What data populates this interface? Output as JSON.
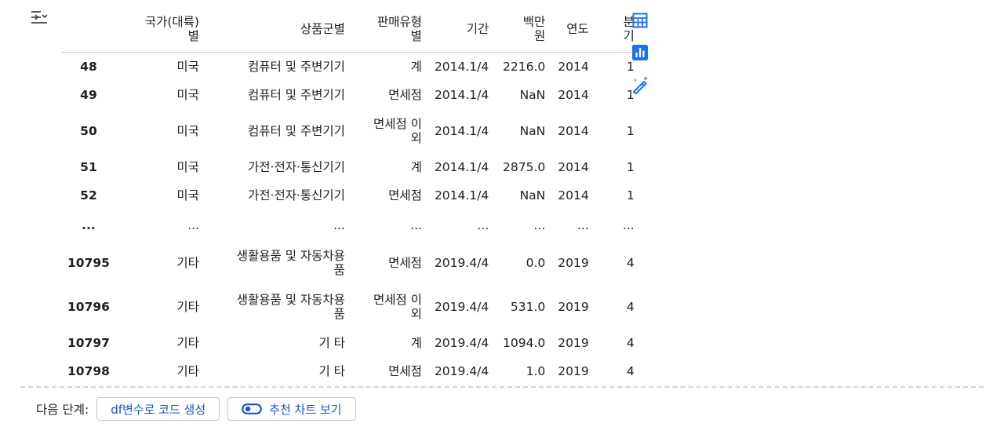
{
  "table": {
    "header": [
      "",
      "국가(대륙)\n별",
      "상품군별",
      "판매유형\n별",
      "기간",
      "백만\n원",
      "연도",
      "분\n기"
    ],
    "rows": [
      {
        "idx": "48",
        "country": "미국",
        "product": "컴퓨터 및 주변기기",
        "sale_type": "계",
        "period": "2014.1/4",
        "amount": "2216.0",
        "year": "2014",
        "quarter": "1",
        "kind": "norm"
      },
      {
        "idx": "49",
        "country": "미국",
        "product": "컴퓨터 및 주변기기",
        "sale_type": "면세점",
        "period": "2014.1/4",
        "amount": "NaN",
        "year": "2014",
        "quarter": "1",
        "kind": "norm"
      },
      {
        "idx": "50",
        "country": "미국",
        "product": "컴퓨터 및 주변기기",
        "sale_type": "면세점 이\n외",
        "period": "2014.1/4",
        "amount": "NaN",
        "year": "2014",
        "quarter": "1",
        "kind": "wrap"
      },
      {
        "idx": "51",
        "country": "미국",
        "product": "가전·전자·통신기기",
        "sale_type": "계",
        "period": "2014.1/4",
        "amount": "2875.0",
        "year": "2014",
        "quarter": "1",
        "kind": "norm"
      },
      {
        "idx": "52",
        "country": "미국",
        "product": "가전·전자·통신기기",
        "sale_type": "면세점",
        "period": "2014.1/4",
        "amount": "NaN",
        "year": "2014",
        "quarter": "1",
        "kind": "norm"
      },
      {
        "idx": "...",
        "country": "...",
        "product": "...",
        "sale_type": "...",
        "period": "...",
        "amount": "...",
        "year": "...",
        "quarter": "...",
        "kind": "ell"
      },
      {
        "idx": "10795",
        "country": "기타",
        "product": "생활용품 및 자동차용\n품",
        "sale_type": "면세점",
        "period": "2019.4/4",
        "amount": "0.0",
        "year": "2019",
        "quarter": "4",
        "kind": "wrap"
      },
      {
        "idx": "10796",
        "country": "기타",
        "product": "생활용품 및 자동차용\n품",
        "sale_type": "면세점 이\n외",
        "period": "2019.4/4",
        "amount": "531.0",
        "year": "2019",
        "quarter": "4",
        "kind": "wrap"
      },
      {
        "idx": "10797",
        "country": "기타",
        "product": "기 타",
        "sale_type": "계",
        "period": "2019.4/4",
        "amount": "1094.0",
        "year": "2019",
        "quarter": "4",
        "kind": "norm"
      },
      {
        "idx": "10798",
        "country": "기타",
        "product": "기 타",
        "sale_type": "면세점",
        "period": "2019.4/4",
        "amount": "1.0",
        "year": "2019",
        "quarter": "4",
        "kind": "norm"
      }
    ]
  },
  "side_tools": [
    {
      "name": "table-view-icon"
    },
    {
      "name": "chart-view-icon"
    },
    {
      "name": "magic-wand-icon"
    }
  ],
  "next_steps": {
    "label": "다음 단계:",
    "buttons": [
      {
        "label": "df변수로 코드 생성"
      },
      {
        "label": "추천 차트 보기"
      }
    ]
  },
  "colors": {
    "accent": "#1a73e8",
    "link": "#1a56c7"
  }
}
